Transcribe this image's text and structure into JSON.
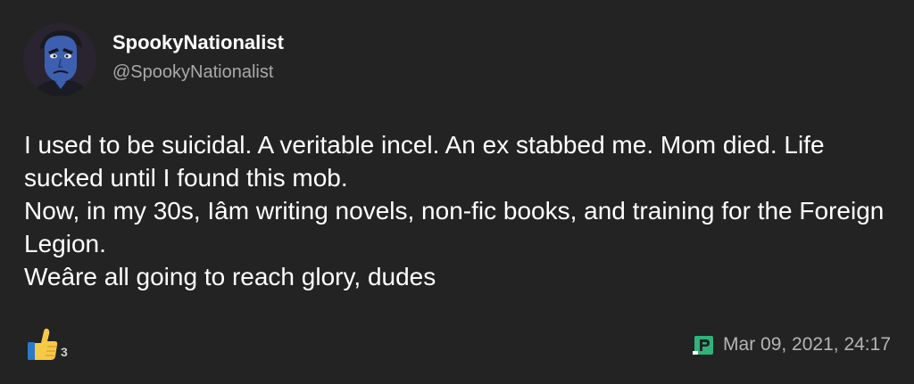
{
  "post": {
    "author": {
      "display_name": "SpookyNationalist",
      "handle": "@SpookyNationalist",
      "avatar_icon": "avatar-cartoon-face"
    },
    "body_lines": [
      "I used to be suicidal. A veritable incel. An ex stabbed me. Mom died. Life sucked until I found this mob.",
      "Now, in my 30s, Iâm writing novels, non-fic books, and training for the Foreign Legion.",
      "Weâre all going to reach glory, dudes"
    ],
    "reactions": {
      "icon": "thumbs-up-icon",
      "count": "3"
    },
    "source_icon": "parler-logo-icon",
    "timestamp": "Mar 09, 2021, 24:17"
  },
  "colors": {
    "background": "#232323",
    "handle": "#a9a9a9",
    "timestamp": "#b5b5b5",
    "brand_green": "#2fb378"
  }
}
